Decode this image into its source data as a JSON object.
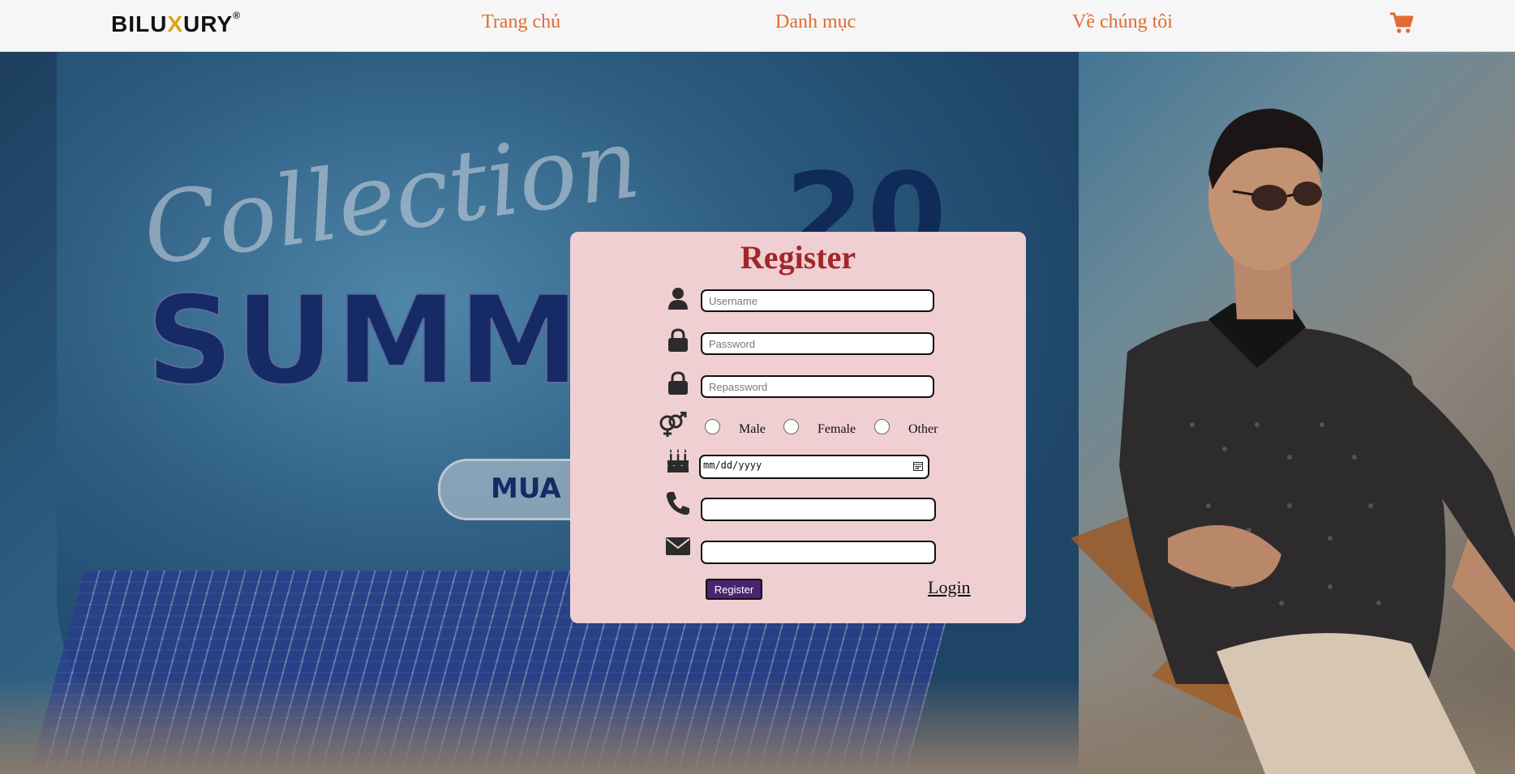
{
  "nav": {
    "logo_parts": [
      "BILU",
      "X",
      "URY"
    ],
    "logo_mark": "®",
    "links": [
      "Trang chủ",
      "Danh mục",
      "Về chúng tôi"
    ],
    "cart_icon": "cart-icon",
    "link_color": "#e36a32"
  },
  "hero": {
    "script_text": "Collection",
    "big_text": "SUMM",
    "number_text": "20",
    "button_text": "MUA N"
  },
  "register": {
    "title": "Register",
    "username_placeholder": "Username",
    "password_placeholder": "Password",
    "repassword_placeholder": "Repassword",
    "gender_options": [
      "Male",
      "Female",
      "Other"
    ],
    "date_placeholder": "mm/dd/yyyy",
    "phone_value": "",
    "email_value": "",
    "submit_label": "Register",
    "login_label": "Login",
    "title_color": "#a3262a",
    "card_color": "#efcfd2",
    "button_color": "#4b2470"
  }
}
